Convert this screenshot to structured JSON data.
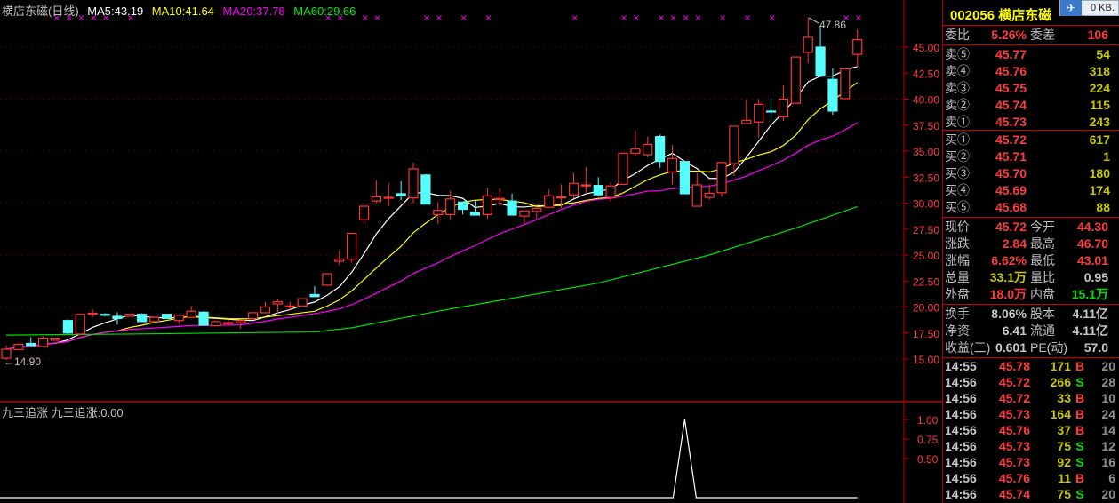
{
  "header": {
    "name": "横店东磁(日线)",
    "ma5": "MA5:43.19",
    "ma10": "MA10:41.64",
    "ma20": "MA20:37.78",
    "ma60": "MA60:29.66"
  },
  "indicator": {
    "title": "九三追涨",
    "value_label": "九三追涨:0.00",
    "axis": [
      "1.00",
      "0.75",
      "0.50"
    ]
  },
  "widget": {
    "speed": "0 KB."
  },
  "chart_data": {
    "type": "candlestick",
    "title": "横店东磁(日线)",
    "y_ticks": [
      "45.00",
      "42.50",
      "40.00",
      "37.50",
      "35.00",
      "32.50",
      "30.00",
      "27.50",
      "25.00",
      "22.50",
      "20.00",
      "17.50",
      "15.00"
    ],
    "ylim": [
      15,
      45
    ],
    "colors": {
      "up": "#ff3232",
      "down": "#54ffff",
      "ma5": "#ffffff",
      "ma10": "#ffff00",
      "ma20": "#ff00ff",
      "ma60": "#00e000",
      "marker": "#ff00ff"
    },
    "annotations": {
      "high": "47.86",
      "low": "←14.90"
    },
    "candles": [
      [
        15.08,
        16.3,
        14.9,
        15.94
      ],
      [
        15.9,
        16.5,
        15.9,
        16.4
      ],
      [
        16.5,
        17.1,
        16.3,
        16.3
      ],
      [
        16.2,
        17.2,
        16.2,
        17.0
      ],
      [
        16.8,
        17.0,
        16.8,
        17.0
      ],
      [
        18.7,
        18.8,
        17.4,
        17.5
      ],
      [
        17.4,
        19.3,
        17.4,
        19.3
      ],
      [
        19.3,
        19.8,
        19.0,
        19.4
      ],
      [
        19.3,
        19.4,
        19.1,
        19.2
      ],
      [
        19.1,
        19.5,
        18.3,
        18.9
      ],
      [
        19.1,
        19.3,
        19.1,
        19.3
      ],
      [
        19.3,
        19.4,
        18.6,
        18.6
      ],
      [
        18.6,
        19.0,
        18.6,
        19.0
      ],
      [
        19.3,
        19.3,
        18.9,
        18.9
      ],
      [
        18.7,
        19.2,
        18.4,
        19.2
      ],
      [
        19.0,
        20.1,
        19.0,
        19.6
      ],
      [
        19.5,
        19.6,
        18.2,
        18.25
      ],
      [
        18.2,
        18.6,
        18.2,
        18.6
      ],
      [
        18.4,
        18.8,
        18.2,
        18.5
      ],
      [
        18.5,
        18.7,
        17.9,
        18.7
      ],
      [
        18.9,
        19.45,
        18.9,
        19.45
      ],
      [
        19.45,
        20.5,
        19.45,
        20.0
      ],
      [
        20.3,
        20.8,
        19.4,
        20.5
      ],
      [
        20.1,
        20.5,
        19.7,
        20.1
      ],
      [
        20.1,
        20.8,
        20.1,
        20.8
      ],
      [
        21.2,
        22.0,
        21.0,
        21.0
      ],
      [
        22.1,
        23.2,
        22.1,
        23.2
      ],
      [
        24.4,
        25.4,
        24.0,
        24.6
      ],
      [
        24.6,
        27.1,
        24.3,
        27.1
      ],
      [
        28.4,
        29.7,
        28.0,
        29.7
      ],
      [
        30.2,
        32.2,
        30.0,
        30.6
      ],
      [
        30.5,
        31.9,
        29.7,
        30.55
      ],
      [
        30.9,
        32.1,
        30.3,
        30.7
      ],
      [
        30.5,
        33.9,
        30.0,
        33.3
      ],
      [
        32.7,
        32.8,
        29.9,
        29.9
      ],
      [
        28.9,
        30.1,
        28.0,
        29.3
      ],
      [
        28.9,
        31.2,
        28.4,
        30.4
      ],
      [
        30.1,
        30.1,
        28.9,
        29.4
      ],
      [
        29.1,
        30.2,
        28.85,
        28.85
      ],
      [
        28.9,
        31.5,
        28.5,
        30.7
      ],
      [
        30.35,
        31.4,
        29.7,
        30.45
      ],
      [
        30.2,
        30.9,
        28.85,
        28.85
      ],
      [
        28.75,
        29.25,
        27.9,
        29.25
      ],
      [
        29.2,
        29.9,
        28.5,
        29.5
      ],
      [
        29.6,
        31.3,
        29.6,
        30.7
      ],
      [
        30.5,
        31.8,
        29.5,
        30.6
      ],
      [
        30.8,
        32.9,
        30.5,
        31.9
      ],
      [
        31.65,
        33.5,
        31.0,
        31.75
      ],
      [
        31.7,
        32.5,
        30.8,
        30.8
      ],
      [
        30.55,
        32.0,
        30.15,
        31.65
      ],
      [
        31.8,
        34.8,
        31.8,
        34.8
      ],
      [
        34.8,
        37.0,
        34.5,
        35.2
      ],
      [
        34.65,
        36.4,
        34.4,
        35.65
      ],
      [
        36.4,
        36.6,
        33.4,
        34.0
      ],
      [
        33.0,
        35.6,
        31.8,
        34.3
      ],
      [
        34.0,
        34.0,
        30.9,
        30.9
      ],
      [
        29.7,
        32.9,
        29.7,
        31.75
      ],
      [
        30.55,
        31.8,
        30.3,
        30.95
      ],
      [
        31.0,
        33.9,
        30.6,
        33.9
      ],
      [
        33.8,
        37.4,
        32.6,
        37.4
      ],
      [
        37.65,
        40.0,
        37.65,
        37.95
      ],
      [
        37.8,
        40.0,
        36.3,
        39.5
      ],
      [
        38.85,
        40.0,
        37.8,
        38.8
      ],
      [
        38.3,
        41.3,
        37.9,
        40.0
      ],
      [
        39.6,
        44.05,
        39.6,
        44.05
      ],
      [
        44.5,
        47.86,
        43.45,
        45.95
      ],
      [
        45.0,
        47.0,
        42.25,
        42.25
      ],
      [
        41.9,
        42.95,
        38.5,
        38.85
      ],
      [
        40.05,
        42.9,
        40.05,
        42.9
      ],
      [
        44.3,
        46.7,
        43.01,
        45.72
      ]
    ],
    "ma60_points": [
      [
        0,
        17.3
      ],
      [
        10,
        17.4
      ],
      [
        25,
        17.6
      ],
      [
        28,
        18.0
      ],
      [
        35,
        19.6
      ],
      [
        48,
        22.3
      ],
      [
        57,
        25.0
      ],
      [
        64,
        27.6
      ],
      [
        69,
        29.66
      ]
    ],
    "signal_markers": [
      4,
      5,
      6,
      7,
      8,
      10,
      26,
      27,
      29,
      30,
      34,
      35,
      37,
      39,
      46,
      50,
      51,
      53,
      54,
      55,
      56,
      58,
      60,
      62,
      68,
      69
    ],
    "indicator_series": {
      "spike_index": 55,
      "spike_value": 1.0,
      "base_value": 0.0
    }
  },
  "panel": {
    "code": "002056",
    "name": "横店东磁",
    "weibi": {
      "label": "委比",
      "value": "5.26%",
      "label2": "委差",
      "value2": "106"
    },
    "sell": [
      {
        "label": "卖⑤",
        "price": "45.77",
        "vol": "54"
      },
      {
        "label": "卖④",
        "price": "45.76",
        "vol": "318"
      },
      {
        "label": "卖③",
        "price": "45.75",
        "vol": "224"
      },
      {
        "label": "卖②",
        "price": "45.74",
        "vol": "115"
      },
      {
        "label": "卖①",
        "price": "45.73",
        "vol": "243"
      }
    ],
    "buy": [
      {
        "label": "买①",
        "price": "45.72",
        "vol": "617"
      },
      {
        "label": "买②",
        "price": "45.71",
        "vol": "1"
      },
      {
        "label": "买③",
        "price": "45.70",
        "vol": "180"
      },
      {
        "label": "买④",
        "price": "45.69",
        "vol": "174"
      },
      {
        "label": "买⑤",
        "price": "45.68",
        "vol": "88"
      }
    ],
    "quote": [
      {
        "l1": "现价",
        "v1": "45.72",
        "c1": "red",
        "l2": "今开",
        "v2": "44.30",
        "c2": "red"
      },
      {
        "l1": "涨跌",
        "v1": "2.84",
        "c1": "red",
        "l2": "最高",
        "v2": "46.70",
        "c2": "red"
      },
      {
        "l1": "涨幅",
        "v1": "6.62%",
        "c1": "red",
        "l2": "最低",
        "v2": "43.01",
        "c2": "red"
      },
      {
        "l1": "总量",
        "v1": "33.1万",
        "c1": "yel",
        "l2": "量比",
        "v2": "0.95",
        "c2": "wht"
      },
      {
        "l1": "外盘",
        "v1": "18.0万",
        "c1": "red",
        "l2": "内盘",
        "v2": "15.1万",
        "c2": "grn"
      }
    ],
    "fin": [
      {
        "l1": "换手",
        "v1": "8.06%",
        "l2": "股本",
        "v2": "4.11亿"
      },
      {
        "l1": "净资",
        "v1": "6.41",
        "l2": "流通",
        "v2": "4.11亿"
      },
      {
        "l1": "收益(三)",
        "v1": "0.601",
        "l2": "PE(动)",
        "v2": "57.0"
      }
    ],
    "trades": [
      {
        "time": "14:55",
        "price": "45.78",
        "vol": "171",
        "side": "B",
        "count": "20"
      },
      {
        "time": "14:56",
        "price": "45.72",
        "vol": "266",
        "side": "S",
        "count": "28"
      },
      {
        "time": "14:56",
        "price": "45.72",
        "vol": "33",
        "side": "B",
        "count": "10"
      },
      {
        "time": "14:56",
        "price": "45.73",
        "vol": "164",
        "side": "B",
        "count": "24"
      },
      {
        "time": "14:56",
        "price": "45.76",
        "vol": "37",
        "side": "B",
        "count": "14"
      },
      {
        "time": "14:56",
        "price": "45.73",
        "vol": "75",
        "side": "S",
        "count": "12"
      },
      {
        "time": "14:56",
        "price": "45.73",
        "vol": "92",
        "side": "S",
        "count": "16"
      },
      {
        "time": "14:56",
        "price": "45.76",
        "vol": "11",
        "side": "B",
        "count": "6"
      },
      {
        "time": "14:56",
        "price": "45.74",
        "vol": "75",
        "side": "S",
        "count": "20"
      }
    ]
  }
}
